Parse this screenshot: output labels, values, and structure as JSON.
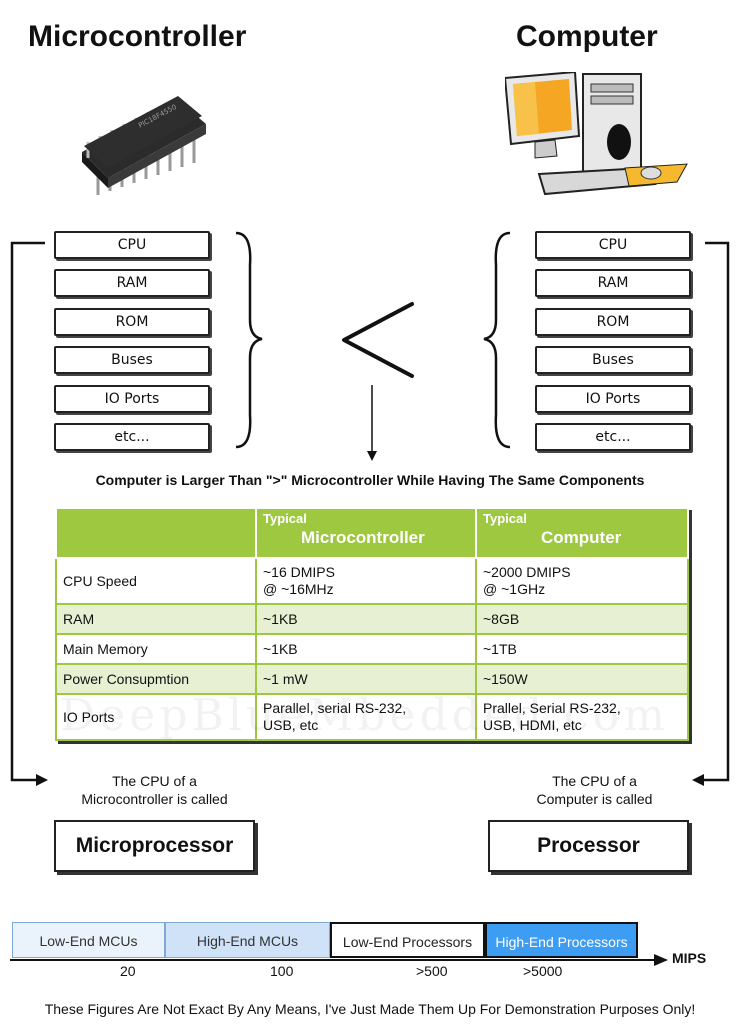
{
  "titles": {
    "left": "Microcontroller",
    "right": "Computer"
  },
  "components": [
    "CPU",
    "RAM",
    "ROM",
    "Buses",
    "IO Ports",
    "etc..."
  ],
  "comparison_symbol": "<",
  "comparison_note": "Computer is Larger Than \">\" Microcontroller While Having The Same Components",
  "table": {
    "headers": [
      {
        "small": "",
        "big": ""
      },
      {
        "small": "Typical",
        "big": "Microcontroller"
      },
      {
        "small": "Typical",
        "big": "Computer"
      }
    ],
    "rows": [
      {
        "label": "CPU Speed",
        "mcu": "~16 DMIPS\n@ ~16MHz",
        "pc": "~2000 DMIPS\n@ ~1GHz"
      },
      {
        "label": "RAM",
        "mcu": "~1KB",
        "pc": "~8GB"
      },
      {
        "label": "Main Memory",
        "mcu": "~1KB",
        "pc": "~1TB"
      },
      {
        "label": "Power Consupmtion",
        "mcu": "~1 mW",
        "pc": "~150W"
      },
      {
        "label": "IO Ports",
        "mcu": "Parallel, serial RS-232,\nUSB, etc",
        "pc": "Prallel, Serial RS-232,\nUSB, HDMI, etc"
      }
    ],
    "watermark": "DeepBlueMbedded.com"
  },
  "left_caption": "The CPU of a\nMicrocontroller is called",
  "right_caption": "The CPU of a\nComputer is called",
  "left_result": "Microprocessor",
  "right_result": "Processor",
  "scale": {
    "segments": [
      "Low-End MCUs",
      "High-End MCUs",
      "Low-End Processors",
      "High-End Processors"
    ],
    "ticks": [
      "20",
      "100",
      ">500",
      ">5000"
    ],
    "axis_label": "MIPS",
    "colors": [
      "#eaf2fb",
      "#cfe2f7",
      "#ffffff",
      "#3d9df2"
    ]
  },
  "footnote": "These Figures Are Not Exact By Any Means, I've Just Made Them Up For Demonstration Purposes Only!"
}
